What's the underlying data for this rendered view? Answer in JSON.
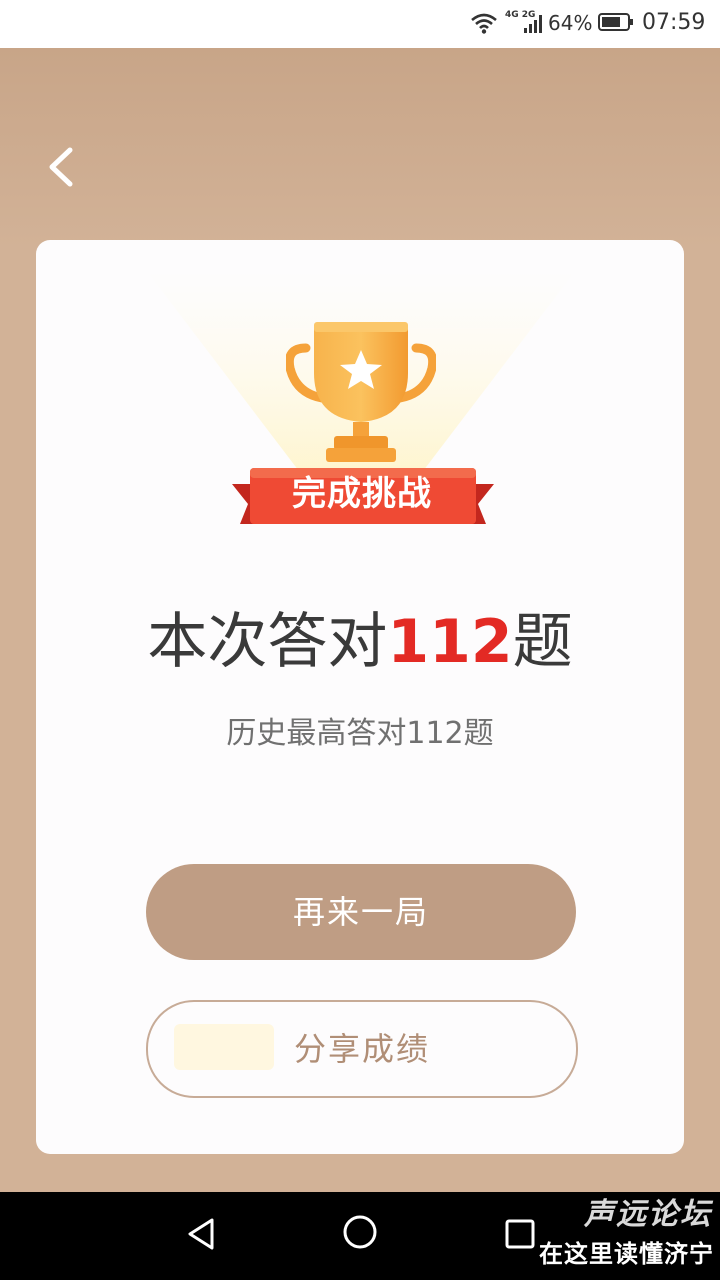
{
  "status_bar": {
    "network_label": "4G 2G",
    "battery_percent": "64%",
    "time": "07:59"
  },
  "header": {
    "back_icon": "chevron-left-icon"
  },
  "result": {
    "badge_text": "完成挑战",
    "prefix": "本次答对",
    "count": "112",
    "suffix": "题",
    "best_text": "历史最高答对112题"
  },
  "actions": {
    "play_again_label": "再来一局",
    "share_label": "分享成绩"
  },
  "nav_bar": {
    "icons": [
      "triangle-back-icon",
      "circle-home-icon",
      "square-recent-icon"
    ]
  },
  "watermark": {
    "line1": "声远论坛",
    "line2": "在这里读懂济宁"
  },
  "colors": {
    "background": "#d2b297",
    "accent_red": "#e32a24",
    "button_brown": "#bf9d84",
    "trophy_orange": "#f5a23a"
  }
}
